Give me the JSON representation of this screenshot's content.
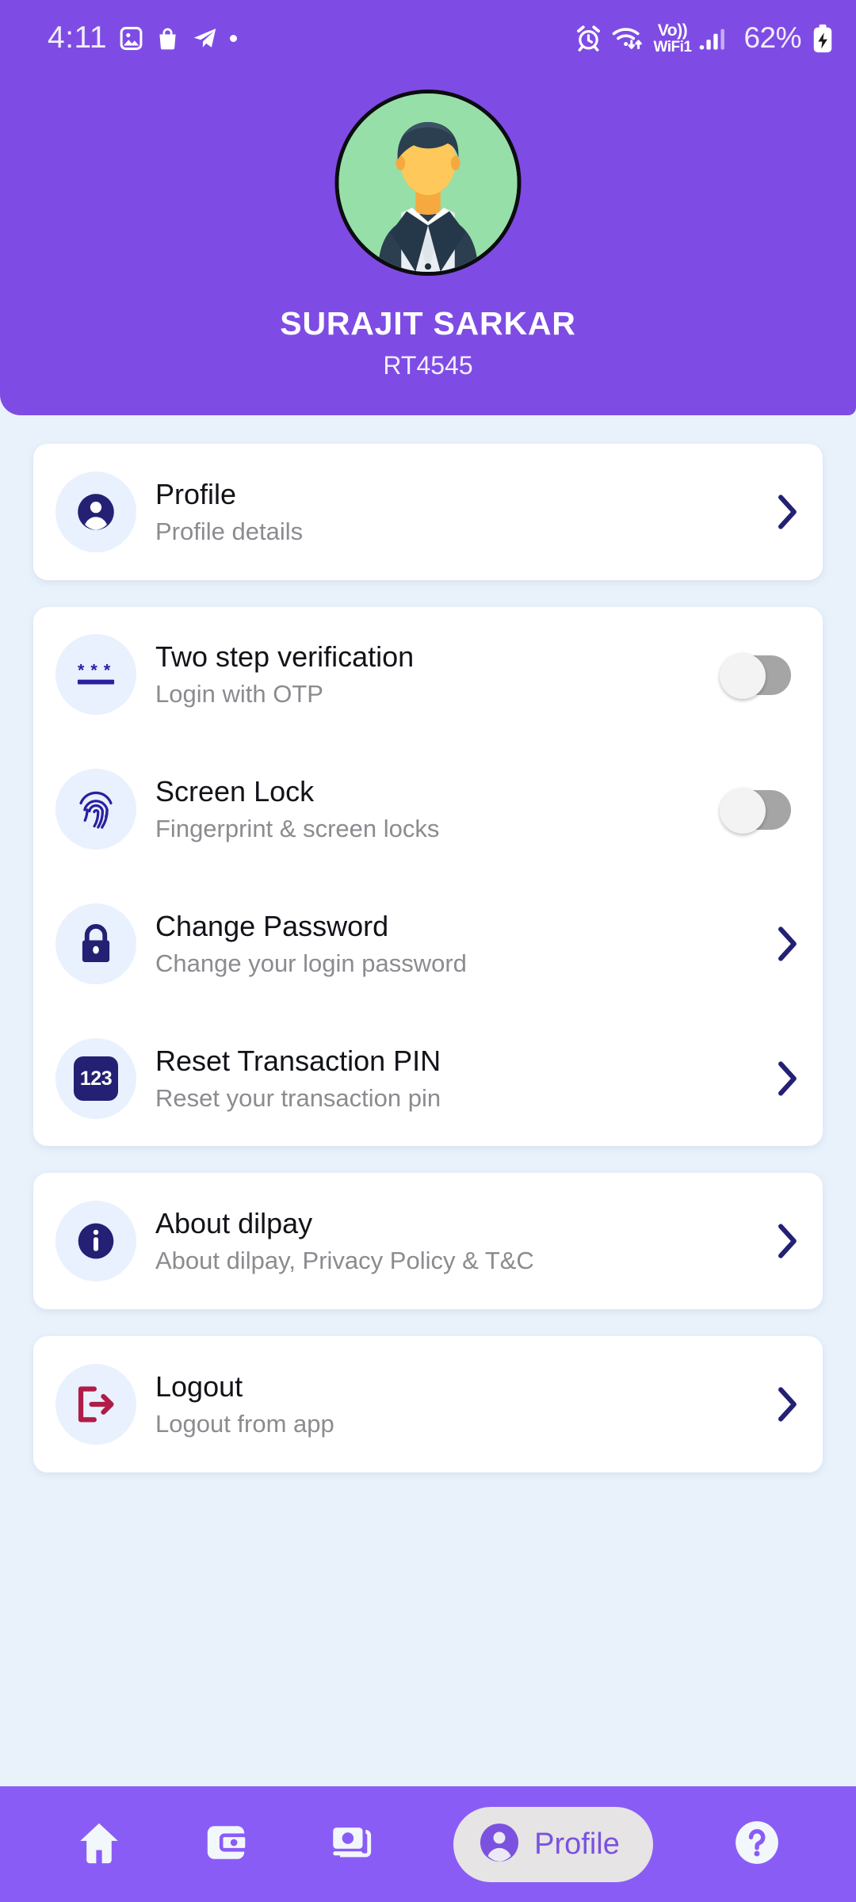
{
  "status_bar": {
    "time": "4:11",
    "left_icons": [
      "image-icon",
      "shopping-bag-icon",
      "telegram-icon",
      "dot-icon"
    ],
    "volte_line1": "Vo))",
    "volte_line2": "WiFi1",
    "battery_percent": "62%",
    "right_icons": [
      "alarm-icon",
      "wifi-icon",
      "volte-icon",
      "signal-icon",
      "battery-charging-icon"
    ]
  },
  "header": {
    "name": "SURAJIT SARKAR",
    "user_id": "RT4545",
    "background_color": "#7e4ce4",
    "avatar_bg_color": "#97dfa8"
  },
  "profile_card": {
    "items": [
      {
        "icon": "person-icon",
        "title": "Profile",
        "subtitle": "Profile details",
        "action": "chevron"
      }
    ]
  },
  "security_card": {
    "items": [
      {
        "icon": "password-asterisks-icon",
        "title": "Two step verification",
        "subtitle": "Login with OTP",
        "action": "toggle",
        "toggle_on": false
      },
      {
        "icon": "fingerprint-icon",
        "title": "Screen Lock",
        "subtitle": "Fingerprint & screen locks",
        "action": "toggle",
        "toggle_on": false
      },
      {
        "icon": "lock-icon",
        "title": "Change Password",
        "subtitle": "Change your login password",
        "action": "chevron"
      },
      {
        "icon": "pin-123-icon",
        "title": "Reset Transaction PIN",
        "subtitle": "Reset your transaction pin",
        "action": "chevron",
        "badge_text": "123"
      }
    ]
  },
  "about_card": {
    "items": [
      {
        "icon": "info-icon",
        "title": "About dilpay",
        "subtitle": "About dilpay, Privacy Policy & T&C",
        "action": "chevron"
      }
    ]
  },
  "logout_card": {
    "items": [
      {
        "icon": "logout-icon",
        "title": "Logout",
        "subtitle": "Logout from app",
        "action": "chevron",
        "icon_color": "#b01c47"
      }
    ]
  },
  "bottom_nav": {
    "background_color": "#8a5cf6",
    "active_label": "Profile",
    "items": [
      {
        "icon": "home-icon",
        "label": "",
        "active": false
      },
      {
        "icon": "wallet-icon",
        "label": "",
        "active": false
      },
      {
        "icon": "cash-icon",
        "label": "",
        "active": false
      },
      {
        "icon": "person-icon",
        "label": "Profile",
        "active": true
      },
      {
        "icon": "help-icon",
        "label": "",
        "active": false
      }
    ]
  },
  "colors": {
    "brand_purple": "#7e4ce4",
    "nav_purple": "#8a5cf6",
    "page_bg": "#e9f2fb",
    "icon_navy": "#242073",
    "icon_bg": "#e8f1fd",
    "logout_red": "#b01c47",
    "subtitle_gray": "#8b8b90"
  }
}
